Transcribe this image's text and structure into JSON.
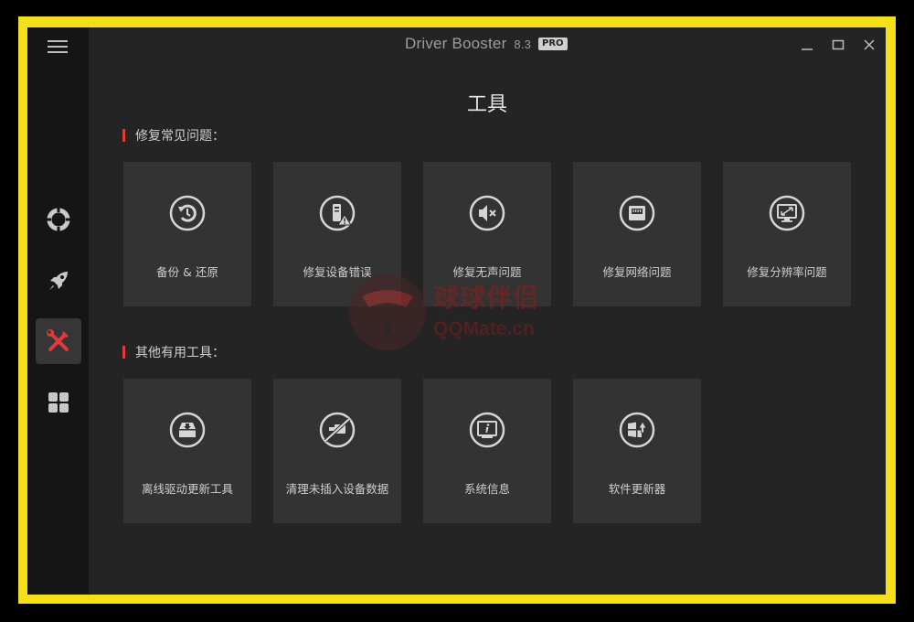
{
  "window": {
    "app_name": "Driver Booster",
    "version": "8.3",
    "badge": "PRO"
  },
  "sidebar": {
    "items": [
      {
        "icon": "lifebuoy-icon"
      },
      {
        "icon": "rocket-icon"
      },
      {
        "icon": "tools-icon",
        "active": true
      },
      {
        "icon": "grid-icon"
      }
    ]
  },
  "page": {
    "title": "工具"
  },
  "sections": [
    {
      "label": "修复常见问题：",
      "tools": [
        {
          "label": "备份 & 还原",
          "icon": "restore-icon"
        },
        {
          "label": "修复设备错误",
          "icon": "device-error-icon"
        },
        {
          "label": "修复无声问题",
          "icon": "mute-icon"
        },
        {
          "label": "修复网络问题",
          "icon": "network-icon"
        },
        {
          "label": "修复分辨率问题",
          "icon": "resolution-icon"
        }
      ]
    },
    {
      "label": "其他有用工具：",
      "tools": [
        {
          "label": "离线驱动更新工具",
          "icon": "offline-driver-icon"
        },
        {
          "label": "清理未插入设备数据",
          "icon": "clean-device-icon"
        },
        {
          "label": "系统信息",
          "icon": "system-info-icon"
        },
        {
          "label": "软件更新器",
          "icon": "software-updater-icon"
        }
      ]
    }
  ],
  "watermark": {
    "name": "球球伴侣",
    "site": "QQMate.cn"
  },
  "colors": {
    "accent": "#e03a3a",
    "frame": "#f5df19",
    "background": "#242424",
    "card": "#333333"
  }
}
